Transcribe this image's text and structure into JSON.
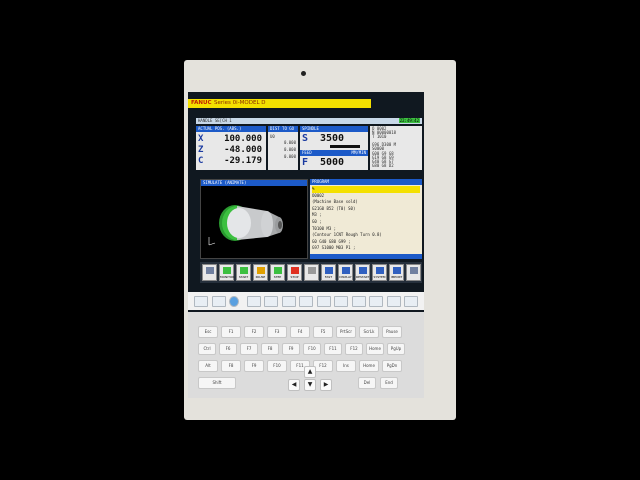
{
  "title": {
    "brand": "FANUC",
    "model": "Series 0i-MODEL D"
  },
  "status_line": {
    "left": "HANDLE  SE[CH 1",
    "right": "22:49:42"
  },
  "position_panel": {
    "header": "ACTUAL POS. (ABS.)",
    "axes": [
      {
        "axis": "X",
        "value": "100.000"
      },
      {
        "axis": "Z",
        "value": "-48.000"
      },
      {
        "axis": "C",
        "value": "-29.179"
      }
    ]
  },
  "dist_panel": {
    "header": "DIST TO GO",
    "lines": [
      "U0",
      "0.000",
      "0.000",
      "0.000"
    ]
  },
  "spindle_panel": {
    "header": "SPINDLE",
    "label": "S",
    "value": "3500"
  },
  "feed_panel": {
    "header": "FEED",
    "label": "F",
    "value": "5000",
    "unit": "MM/MIN"
  },
  "info_panel": {
    "lines": [
      "O 0002",
      "N 00000018",
      "T 1010",
      "",
      "G96  D300  M",
      "S0000",
      "G00  G9  G8",
      "G19  G8  G9",
      "G40  G8  G7",
      "G80  G8  D2"
    ]
  },
  "simulate_panel": {
    "header": "SIMULATE (ANIMATE)"
  },
  "program_panel": {
    "header": "PROGRAM",
    "lines": [
      "%",
      "O0002",
      "(Machine Base sold)",
      "G21G0 B52 (T0) S0)",
      "M3 ;",
      "",
      "G0 ;",
      "T0100 M3 ;",
      "(Contour 1CNT Rough Turn 0.8)",
      "G0 G40 G80 G99 ;",
      "G97 S1000 M03 P1 ;",
      "G50 S2000 ;",
      "G96 S150 P11 ;",
      "..."
    ]
  },
  "softkeys": [
    {
      "icon": "arrow-left-icon",
      "label": ""
    },
    {
      "icon": "monitor-icon",
      "label": "MONITOR"
    },
    {
      "icon": "play-icon",
      "label": "START"
    },
    {
      "icon": "pause-icon",
      "label": "PAUSE"
    },
    {
      "icon": "step-icon",
      "label": "STEP"
    },
    {
      "icon": "stop-icon",
      "label": "STOP"
    },
    {
      "icon": "blank-icon",
      "label": ""
    },
    {
      "icon": "fast-icon",
      "label": "FAST"
    },
    {
      "icon": "display-icon",
      "label": "DISPLAY"
    },
    {
      "icon": "restart-icon",
      "label": "RESTART"
    },
    {
      "icon": "settings-icon",
      "label": "SYSTEM"
    },
    {
      "icon": "import-icon",
      "label": "IMPORT"
    },
    {
      "icon": "arrow-right-icon",
      "label": ""
    }
  ],
  "keyboard": {
    "row1": [
      "Esc",
      "F1",
      "F2",
      "F3",
      "F4",
      "F5",
      "PrtScr",
      "ScrLk",
      "Pause"
    ],
    "row2": [
      "Ctrl",
      "F6",
      "F7",
      "F8",
      "F9",
      "F10",
      "F11",
      "F12",
      "Home",
      "PgUp"
    ],
    "row3": [
      "Alt",
      "F8",
      "F9",
      "F10",
      "F11",
      "F12",
      "Ins",
      "Home",
      "PgDn"
    ],
    "row4": [
      "Shift",
      "Del",
      "End"
    ],
    "arrows": [
      "▲",
      "◀",
      "▼",
      "▶"
    ]
  },
  "colors": {
    "accent": "#1c5ac8",
    "brand_bar": "#f4e000",
    "model_green": "#3cc040"
  }
}
